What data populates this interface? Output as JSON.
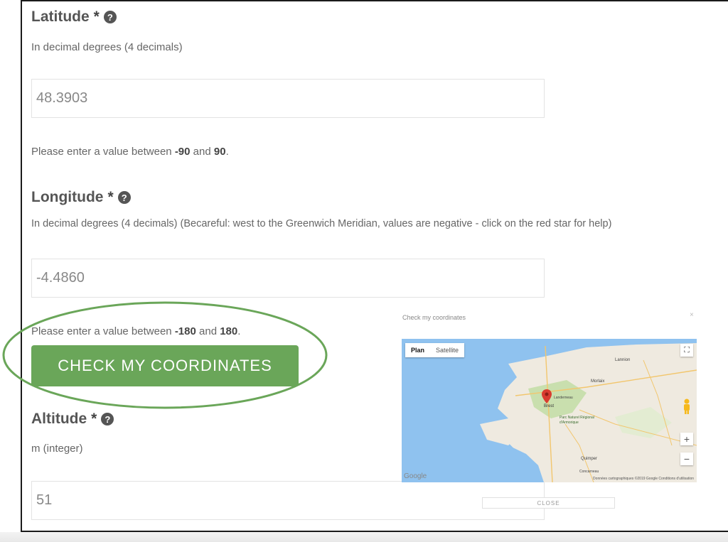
{
  "latitude": {
    "label": "Latitude",
    "required_mark": "*",
    "help_glyph": "?",
    "hint": "In decimal degrees (4 decimals)",
    "value": "48.3903",
    "range_prefix": "Please enter a value between ",
    "range_min": "-90",
    "range_and": " and ",
    "range_max": "90",
    "range_suffix": "."
  },
  "longitude": {
    "label": "Longitude",
    "required_mark": "*",
    "help_glyph": "?",
    "hint": "In decimal degrees (4 decimals) (Becareful: west to the Greenwich Meridian, values are negative - click on the red star for help)",
    "value": "-4.4860",
    "range_prefix": "Please enter a value between ",
    "range_min": "-180",
    "range_and": " and ",
    "range_max": "180",
    "range_suffix": "."
  },
  "check_button": {
    "label": "CHECK MY COORDINATES"
  },
  "altitude": {
    "label": "Altitude",
    "required_mark": "*",
    "help_glyph": "?",
    "hint": "m (integer)",
    "value": "51"
  },
  "map_popup": {
    "title": "Check my coordinates",
    "close_x": "×",
    "tabs": [
      "Plan",
      "Satellite"
    ],
    "active_tab": "Plan",
    "zoom_in": "+",
    "zoom_out": "−",
    "fullscreen": "⛶",
    "google_logo": "Google",
    "attribution": "Données cartographiques ©2019 Google   Conditions d'utilisation",
    "place_labels": [
      "Brest",
      "Morlaix",
      "Landerneau",
      "Parc Naturel Régional d'Armorique",
      "Quimper",
      "Concarneau",
      "Lannion"
    ],
    "close_button": "CLOSE",
    "colors": {
      "sea": "#8fc2ef",
      "land": "#efeae0",
      "park": "#c9dfae",
      "marker": "#d93b30"
    }
  },
  "highlight_color": "#6aa659"
}
